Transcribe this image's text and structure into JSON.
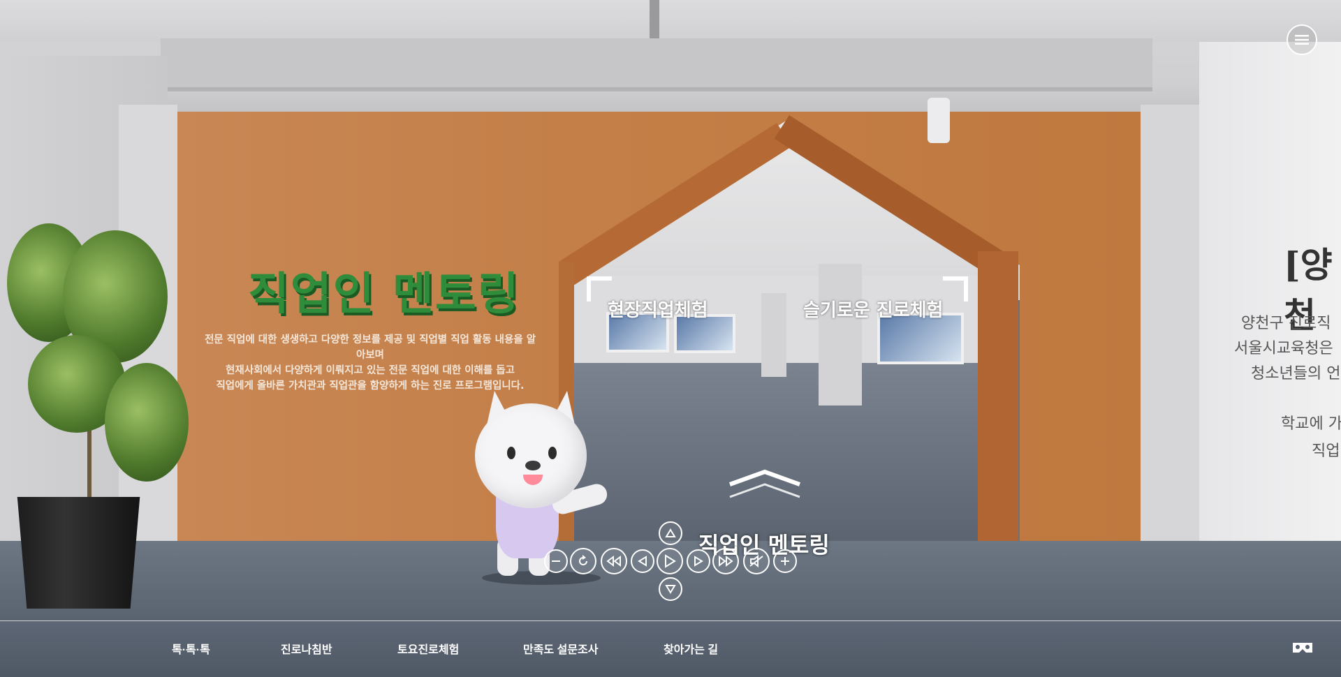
{
  "scene": {
    "sign_title": "직업인 멘토링",
    "sign_description": [
      "전문 직업에 대한 생생하고 다양한 정보를 제공 및 직업별 직업 활동 내용을 알아보며",
      "현재사회에서 다양하게 이뤄지고 있는 전문 직업에 대한 이해를 돕고",
      "직업에게 올바른 가치관과 직업관을 함양하게 하는 진로 프로그램입니다."
    ],
    "right_wall_title": "[양천",
    "right_wall_lines": [
      "양천구 진로직",
      "서울시교육청은",
      "청소년들의 언",
      "",
      "학교에 가",
      "직업"
    ],
    "hotspots": [
      {
        "label": "현장직업체험"
      },
      {
        "label": "슬기로운 진로체험"
      }
    ],
    "current_scene_name": "직업인 멘토링"
  },
  "controls": {
    "up": "up-arrow-icon",
    "down": "down-arrow-icon",
    "zoom_out": "minus-icon",
    "reset": "rotate-icon",
    "rewind": "rewind-icon",
    "left": "left-arrow-icon",
    "play": "play-icon",
    "right": "right-arrow-icon",
    "fast_forward": "fast-forward-icon",
    "mute": "mute-icon",
    "zoom_in": "plus-icon"
  },
  "bottom_nav": {
    "items": [
      {
        "label": "톡·톡·톡"
      },
      {
        "label": "진로나침반"
      },
      {
        "label": "토요진로체험"
      },
      {
        "label": "만족도 설문조사"
      },
      {
        "label": "찾아가는 길"
      }
    ]
  },
  "colors": {
    "accent_green": "#2f8c3a",
    "wall_orange": "#c88755",
    "bottom_bar": "#56606d"
  }
}
